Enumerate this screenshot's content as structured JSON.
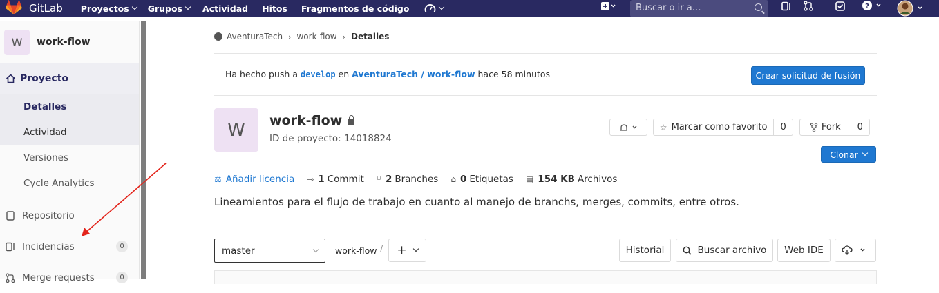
{
  "navbar": {
    "brand": "GitLab",
    "items": [
      {
        "label": "Proyectos",
        "dropdown": true
      },
      {
        "label": "Grupos",
        "dropdown": true
      },
      {
        "label": "Actividad",
        "dropdown": false
      },
      {
        "label": "Hitos",
        "dropdown": false
      },
      {
        "label": "Fragmentos de código",
        "dropdown": false
      }
    ],
    "search_placeholder": "Buscar o ir a…",
    "icons": [
      "gauge-icon",
      "plus-square-icon",
      "issues-icon",
      "merge-request-icon",
      "todo-icon",
      "help-icon",
      "user-avatar"
    ],
    "colors": {
      "navbar_bg": "#292961",
      "search_bg": "#4b4b7e"
    }
  },
  "sidebar": {
    "project_avatar_letter": "W",
    "project_name": "work-flow",
    "section_label": "Proyecto",
    "sub_items": [
      {
        "label": "Detalles",
        "active": true
      },
      {
        "label": "Actividad",
        "active": false
      },
      {
        "label": "Versiones",
        "active": false
      },
      {
        "label": "Cycle Analytics",
        "active": false
      }
    ],
    "items": [
      {
        "label": "Repositorio",
        "count": ""
      },
      {
        "label": "Incidencias",
        "count": "0"
      },
      {
        "label": "Merge requests",
        "count": "0"
      }
    ]
  },
  "breadcrumb": {
    "group": "AventuraTech",
    "project": "work-flow",
    "current": "Detalles"
  },
  "push_banner": {
    "text_before": "Ha hecho push a",
    "branch": "develop",
    "text_mid": "en",
    "project_path": "AventuraTech / work-flow",
    "text_after": "hace 58 minutos",
    "button": "Crear solicitud de fusión"
  },
  "project": {
    "avatar_letter": "W",
    "name": "work-flow",
    "id_text": "ID de proyecto: 14018824",
    "star_label": "Marcar como favorito",
    "star_count": "0",
    "fork_label": "Fork",
    "fork_count": "0",
    "clone_label": "Clonar",
    "stats": {
      "license": "Añadir licencia",
      "commits_num": "1",
      "commits_label": "Commit",
      "branches_num": "2",
      "branches_label": "Branches",
      "tags_num": "0",
      "tags_label": "Etiquetas",
      "size_num": "154 KB",
      "size_label": "Archivos"
    },
    "description": "Lineamientos para el flujo de trabajo en cuanto al manejo de branchs, merges, commits, entre otros."
  },
  "repo_toolbar": {
    "branch": "master",
    "path": "work-flow",
    "path_sep": "/",
    "add_label": "+",
    "history": "Historial",
    "find_file": "Buscar archivo",
    "web_ide": "Web IDE"
  },
  "colors": {
    "primary": "#1f78d1",
    "annotation_arrow": "#e3241b",
    "avatar_bg": "#eee1f3"
  }
}
